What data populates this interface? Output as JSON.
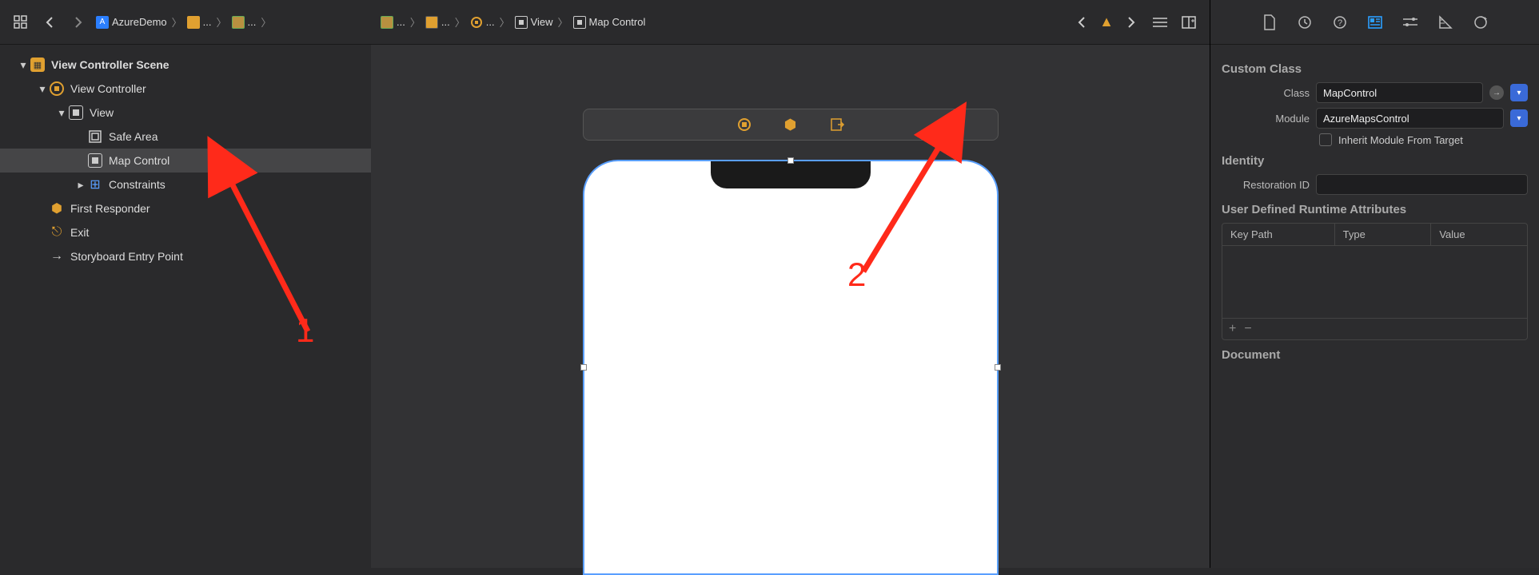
{
  "breadcrumb": {
    "project": "AzureDemo",
    "items": [
      "...",
      "...",
      "...",
      "...",
      "...",
      "View",
      "Map Control"
    ]
  },
  "outline": {
    "scene": "View Controller Scene",
    "vc": "View Controller",
    "view": "View",
    "safearea": "Safe Area",
    "mapcontrol": "Map Control",
    "constraints": "Constraints",
    "firstresponder": "First Responder",
    "exit": "Exit",
    "entrypoint": "Storyboard Entry Point"
  },
  "inspector": {
    "custom_class_title": "Custom Class",
    "class_label": "Class",
    "class_value": "MapControl",
    "module_label": "Module",
    "module_value": "AzureMapsControl",
    "inherit_label": "Inherit Module From Target",
    "identity_title": "Identity",
    "restoration_label": "Restoration ID",
    "restoration_value": "",
    "udra_title": "User Defined Runtime Attributes",
    "col_keypath": "Key Path",
    "col_type": "Type",
    "col_value": "Value",
    "document_title": "Document"
  },
  "annotations": {
    "one": "1",
    "two": "2"
  }
}
